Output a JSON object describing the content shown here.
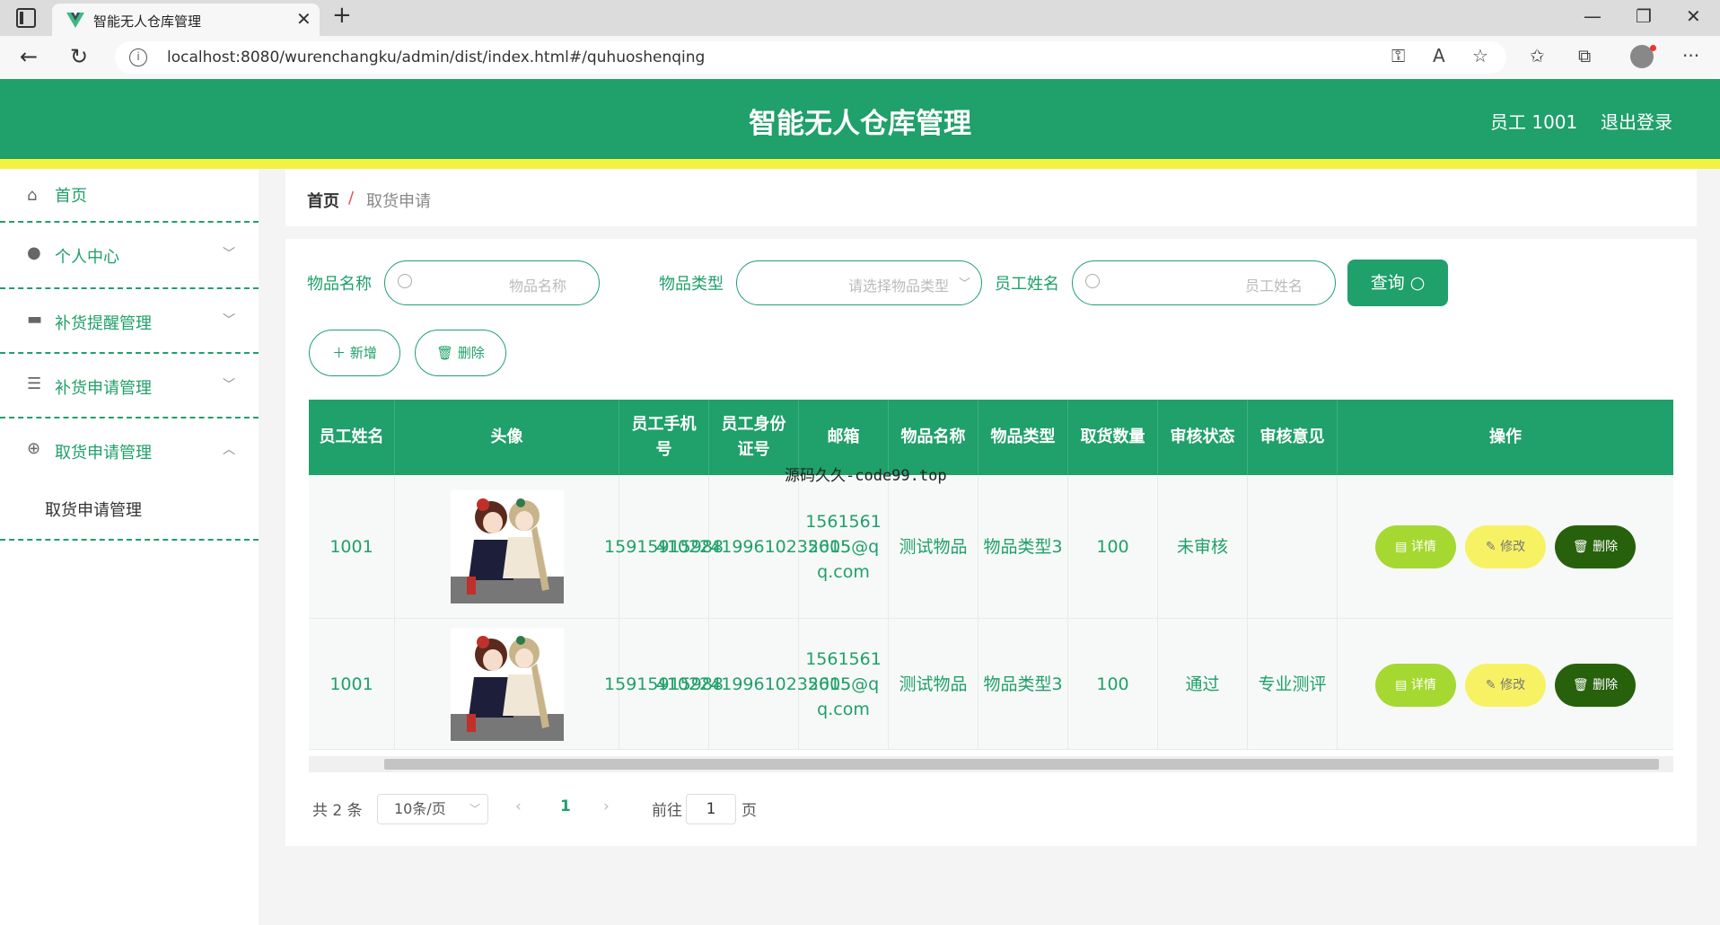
{
  "browser": {
    "tab_title": "智能无人仓库管理",
    "url": "localhost:8080/wurenchangku/admin/dist/index.html#/quhuoshenqing",
    "controls": {
      "minimize": "—",
      "restore": "❐",
      "close": "✕",
      "tab_close": "✕",
      "new_tab": "+"
    },
    "icons": [
      "back-icon",
      "refresh-icon",
      "info-icon",
      "key-icon",
      "read-aloud-icon",
      "favorite-icon",
      "favorites-bar-icon",
      "collections-icon",
      "profile-icon",
      "more-icon"
    ]
  },
  "header": {
    "title": "智能无人仓库管理",
    "user": "员工 1001",
    "logout": "退出登录",
    "color": "#20a06a",
    "accent_line": "#f2f240"
  },
  "sidebar": {
    "items": [
      {
        "label": "首页",
        "icon": "home-icon"
      },
      {
        "label": "个人中心",
        "icon": "user-icon"
      },
      {
        "label": "补货提醒管理",
        "icon": "monitor-icon"
      },
      {
        "label": "补货申请管理",
        "icon": "list-icon"
      },
      {
        "label": "取货申请管理",
        "icon": "globe-icon"
      }
    ],
    "sub_items": [
      {
        "label": "取货申请管理"
      }
    ]
  },
  "breadcrumb": {
    "home": "首页",
    "separator": "/",
    "current": "取货申请"
  },
  "search": {
    "item_name_label": "物品名称",
    "item_name_placeholder": "物品名称",
    "item_type_label": "物品类型",
    "item_type_placeholder": "请选择物品类型",
    "employee_label": "员工姓名",
    "employee_placeholder": "员工姓名",
    "query_button": "查询 ○"
  },
  "actions": {
    "add": "＋ 新增",
    "delete": "🗑 删除"
  },
  "table": {
    "headers": [
      "员工姓名",
      "头像",
      "员工手机号",
      "员工身份证号",
      "邮箱",
      "物品名称",
      "物品类型",
      "取货数量",
      "审核状态",
      "审核意见",
      "操作"
    ],
    "rows": [
      {
        "name": "1001",
        "phone": "15915915988",
        "id_card": "410224199610232005",
        "email": "15615615615@qq.com",
        "item_name": "测试物品",
        "item_type": "物品类型3",
        "quantity": "100",
        "status": "未审核",
        "opinion": ""
      },
      {
        "name": "1001",
        "phone": "15915915988",
        "id_card": "410224199610232005",
        "email": "15615615615@qq.com",
        "item_name": "测试物品",
        "item_type": "物品类型3",
        "quantity": "100",
        "status": "通过",
        "opinion": "专业测评"
      }
    ],
    "op_buttons": {
      "detail": "▤ 详情",
      "edit": "✎ 修改",
      "delete": "🗑 删除"
    }
  },
  "pagination": {
    "total": "共 2 条",
    "page_size": "10条/页",
    "current_page": "1",
    "goto_prefix": "前往",
    "goto_value": "1",
    "goto_suffix": "页"
  },
  "overlay_text": "源码久久-code99.top"
}
